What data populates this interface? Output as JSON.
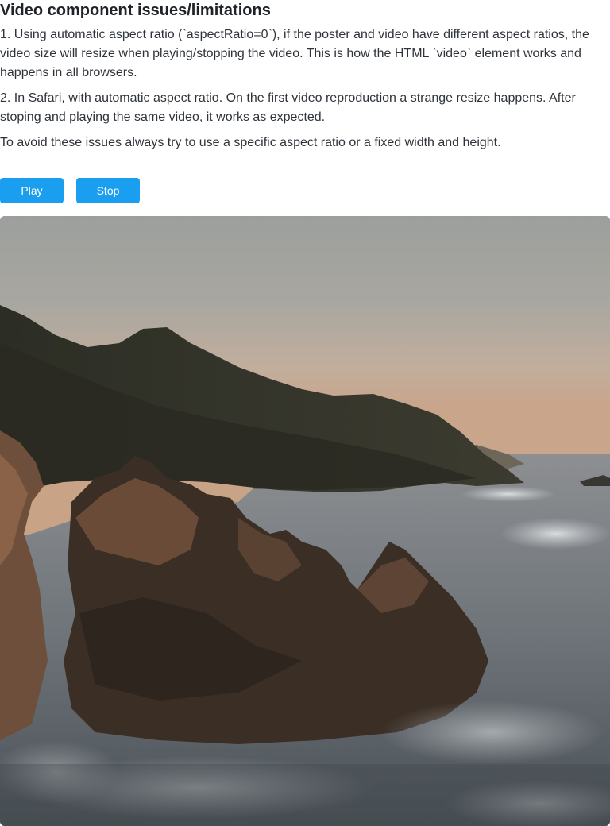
{
  "page": {
    "title": "Video component issues/limitations",
    "paragraphs": [
      "1. Using automatic aspect ratio (`aspectRatio=0`), if the poster and video have different aspect ratios, the video size will resize when playing/stopping the video. This is how the HTML `video` element works and happens in all browsers.",
      "2. In Safari, with automatic aspect ratio. On the first video reproduction a strange resize happens. After stoping and playing the same video, it works as expected.",
      "To avoid these issues always try to use a specific aspect ratio or a fixed width and height."
    ]
  },
  "controls": {
    "play_label": "Play",
    "stop_label": "Stop"
  },
  "video": {
    "poster_subject": "coastal-rocks-at-dusk"
  },
  "colors": {
    "button_bg": "#1a9ff0",
    "button_text": "#ffffff",
    "title_text": "#1f2329",
    "body_text": "#2f343b"
  }
}
